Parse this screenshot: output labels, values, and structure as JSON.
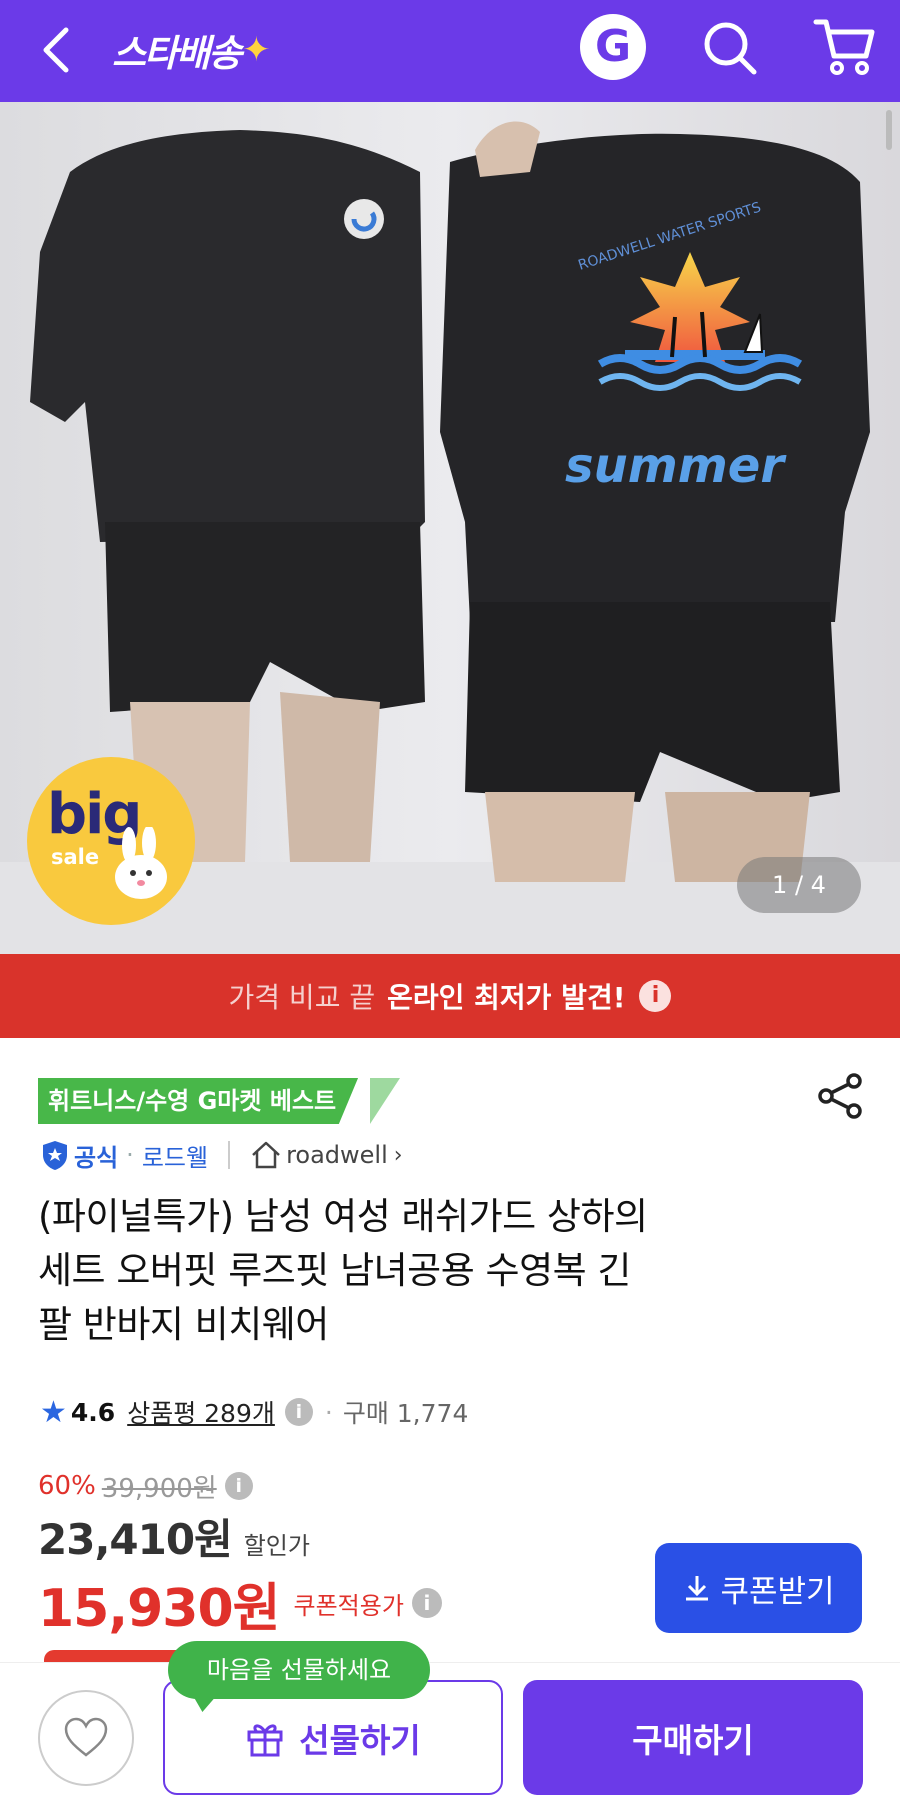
{
  "header": {
    "logo_text": "스타배송",
    "logo_spark": "✦",
    "g_label": "G"
  },
  "hero": {
    "badge_big": "big",
    "badge_sale": "sale",
    "page_indicator": "1 / 4"
  },
  "banner": {
    "lead": "가격 비교 끝",
    "strong": "온라인 최저가 발견!",
    "info": "i"
  },
  "product": {
    "best_tag": "휘트니스/수영 G마켓 베스트",
    "seller_official": "공식",
    "seller_dot": "·",
    "seller_store": "로드웰",
    "brand": "roadwell",
    "brand_chevron": "›",
    "title_lines": [
      "(파이널특가) 남성 여성 래쉬가드 상하의",
      "세트 오버핏 루즈핏 남녀공용 수영복 긴",
      "팔 반바지 비치웨어"
    ],
    "rating": {
      "star": "★",
      "score": "4.6",
      "reviews": "상품평 289개",
      "info": "i",
      "dot": "·",
      "purchase": "구매 1,774"
    },
    "price": {
      "discount_pct": "60%",
      "original": "39,900원",
      "info": "i",
      "sale": "23,410원",
      "sale_label": "할인가",
      "coupon_price": "15,930원",
      "coupon_label": "쿠폰적용가",
      "coupon_info": "i"
    },
    "coupon_button": "쿠폰받기"
  },
  "bottom": {
    "gift_tooltip": "마음을 선물하세요",
    "gift_button": "선물하기",
    "buy_button": "구매하기"
  },
  "colors": {
    "brand_purple": "#6b3ae8",
    "banner_red": "#d9332b",
    "best_green": "#48b749",
    "coupon_blue": "#2a50e6",
    "price_red": "#e0312b"
  },
  "icons": {
    "back": "back-arrow-icon",
    "search": "search-icon",
    "cart": "cart-icon",
    "share": "share-icon",
    "heart": "heart-icon",
    "gift": "gift-icon",
    "download": "download-icon",
    "shield": "shield-icon",
    "home": "home-icon"
  }
}
